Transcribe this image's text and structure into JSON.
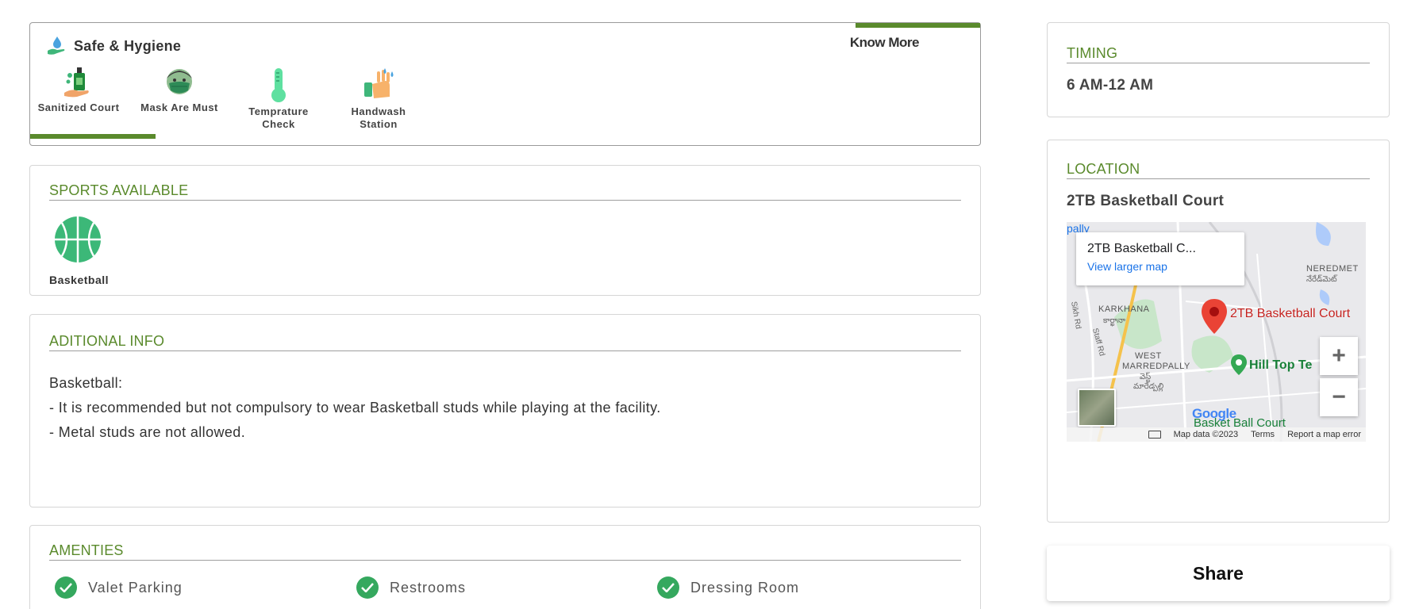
{
  "safe_hygiene": {
    "title": "Safe & Hygiene",
    "know_more_label": "Know More",
    "items": [
      {
        "label": "Sanitized Court",
        "icon": "sanitizer-icon"
      },
      {
        "label": "Mask Are Must",
        "icon": "mask-icon"
      },
      {
        "label": "Temprature Check",
        "icon": "thermometer-icon"
      },
      {
        "label": "Handwash Station",
        "icon": "handwash-icon"
      }
    ]
  },
  "sports": {
    "title": "SPORTS AVAILABLE",
    "items": [
      {
        "label": "Basketball",
        "icon": "basketball-icon"
      }
    ]
  },
  "additional_info": {
    "title": "ADITIONAL INFO",
    "lines": [
      "Basketball:",
      "- It is recommended but not compulsory to wear Basketball studs while playing at the facility.",
      "- Metal studs are not allowed."
    ]
  },
  "amenities": {
    "title": "AMENTIES",
    "items": [
      "Valet Parking",
      "Restrooms",
      "Dressing Room"
    ]
  },
  "timing": {
    "title": "TIMING",
    "value": "6 AM-12 AM"
  },
  "location": {
    "title": "LOCATION",
    "name": "2TB Basketball Court",
    "map": {
      "info_title": "2TB Basketball C...",
      "info_link": "View larger map",
      "marker_label": "2TB Basketball Court",
      "places": [
        "KARKHANA",
        "కార్ఖానా",
        "WEST",
        "MARREDPALLY",
        "వెస్ట్",
        "మారేడ్పల్లి",
        "NEREDMET",
        "నేరేడ్‌మెట్",
        "Hill Top Te",
        "Basket Ball Court",
        "Sikh Rd",
        "Staff Rd",
        "pally"
      ],
      "logo": "Google",
      "zoom_in": "+",
      "zoom_out": "−",
      "footer": {
        "data": "Map data ©2023",
        "terms": "Terms",
        "report": "Report a map error"
      }
    }
  },
  "share_label": "Share",
  "colors": {
    "accent": "#5a8a2c",
    "check": "#35a85e",
    "link": "#1a73e8",
    "marker": "#ea4335"
  }
}
